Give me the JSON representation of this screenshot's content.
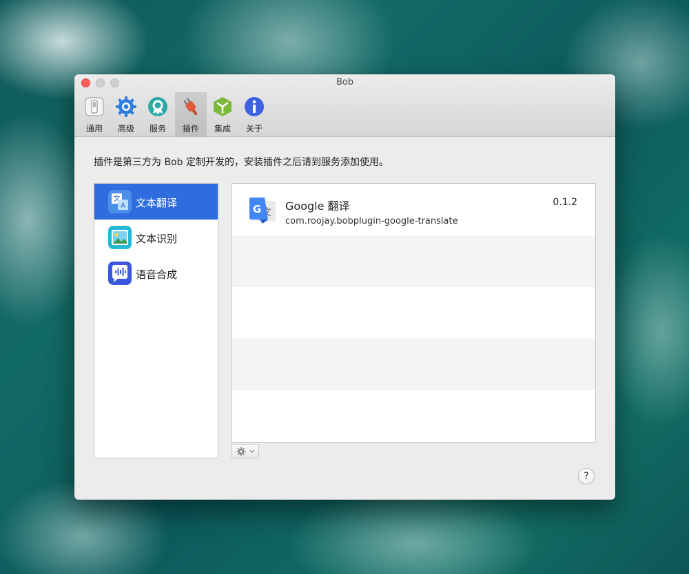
{
  "window": {
    "title": "Bob"
  },
  "toolbar": {
    "items": [
      {
        "label": "通用",
        "icon": "switch-icon"
      },
      {
        "label": "高级",
        "icon": "gear-icon"
      },
      {
        "label": "服务",
        "icon": "badge-icon"
      },
      {
        "label": "插件",
        "icon": "plug-icon",
        "active": true
      },
      {
        "label": "集成",
        "icon": "cube-icon"
      },
      {
        "label": "关于",
        "icon": "info-icon"
      }
    ]
  },
  "description": "插件是第三方为 Bob 定制开发的，安装插件之后请到服务添加使用。",
  "sidebar": {
    "items": [
      {
        "label": "文本翻译",
        "icon": "translate-icon",
        "selected": true
      },
      {
        "label": "文本识别",
        "icon": "image-recognition-icon"
      },
      {
        "label": "语音合成",
        "icon": "speech-icon"
      }
    ]
  },
  "plugins": [
    {
      "name": "Google 翻译",
      "id": "com.roojay.bobplugin-google-translate",
      "version": "0.1.2",
      "icon": "google-translate-icon"
    }
  ],
  "footer": {
    "help": "?"
  },
  "colors": {
    "accent": "#2f6ddf",
    "close": "#fd5f57"
  }
}
